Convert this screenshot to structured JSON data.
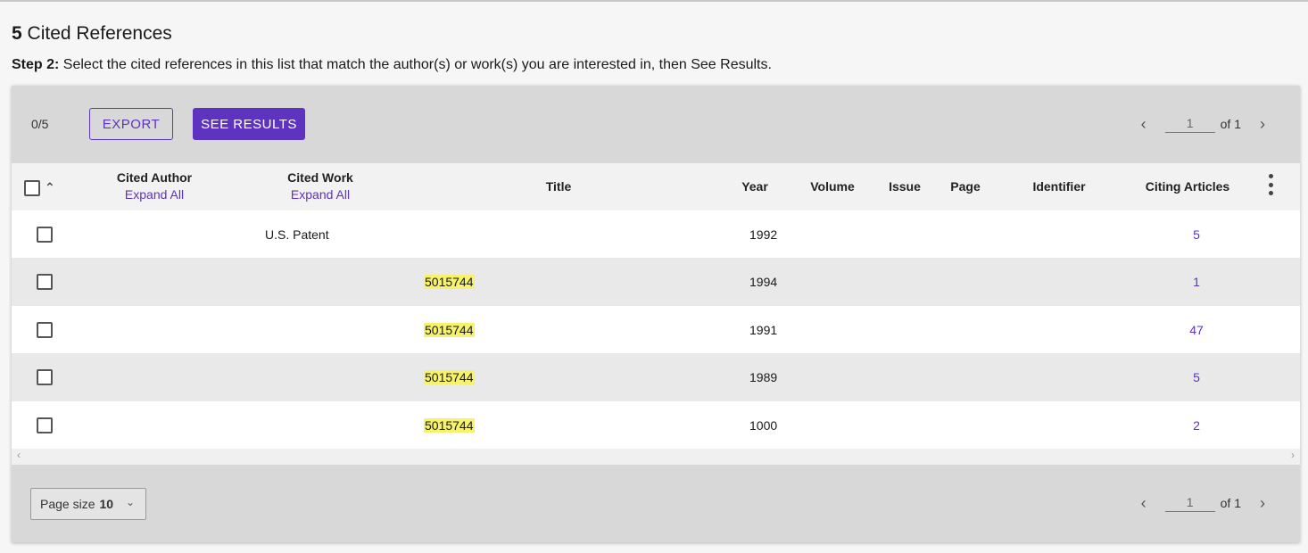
{
  "header": {
    "count": "5",
    "title": "Cited References",
    "step_label": "Step 2:",
    "step_text": "Select the cited references in this list that match the author(s) or work(s) you are interested in, then See Results."
  },
  "toolbar": {
    "selection_count": "0/5",
    "export_label": "EXPORT",
    "see_results_label": "SEE RESULTS"
  },
  "pagination": {
    "prev_icon": "chevron-left-icon",
    "next_icon": "chevron-right-icon",
    "current_page": "1",
    "of_text": "of 1"
  },
  "columns": {
    "cited_author": "Cited Author",
    "cited_work": "Cited Work",
    "expand_all": "Expand All",
    "title": "Title",
    "year": "Year",
    "volume": "Volume",
    "issue": "Issue",
    "page": "Page",
    "identifier": "Identifier",
    "citing_articles": "Citing Articles"
  },
  "rows": [
    {
      "cited_author": "",
      "cited_work": "U.S. Patent",
      "title": "",
      "year": "1992",
      "citing_articles": "5"
    },
    {
      "cited_author": "",
      "cited_work": "",
      "title": "5015744",
      "year": "1994",
      "citing_articles": "1"
    },
    {
      "cited_author": "",
      "cited_work": "",
      "title": "5015744",
      "year": "1991",
      "citing_articles": "47"
    },
    {
      "cited_author": "",
      "cited_work": "",
      "title": "5015744",
      "year": "1989",
      "citing_articles": "5"
    },
    {
      "cited_author": "",
      "cited_work": "",
      "title": "5015744",
      "year": "1000",
      "citing_articles": "2"
    }
  ],
  "footer": {
    "page_size_label": "Page size",
    "page_size_value": "10"
  },
  "colors": {
    "accent": "#5e33bf",
    "highlight": "#f7f26b"
  }
}
